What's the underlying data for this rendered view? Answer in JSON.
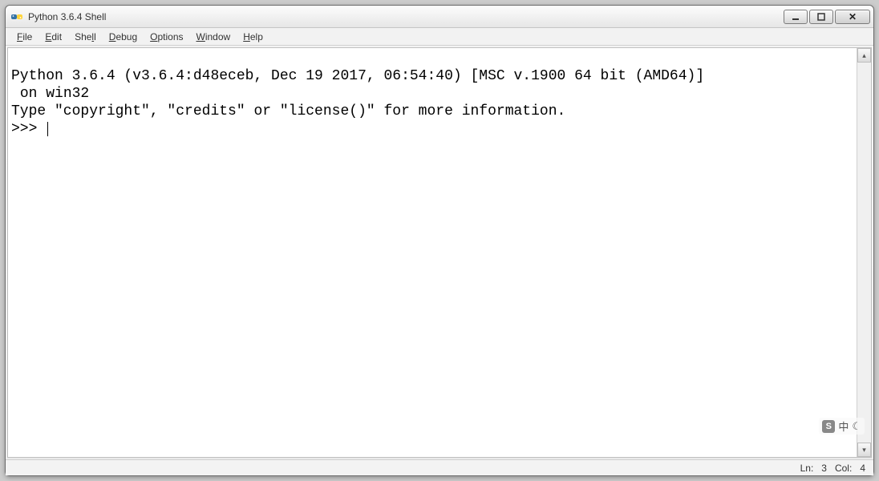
{
  "window": {
    "title": "Python 3.6.4 Shell"
  },
  "menubar": {
    "items": [
      {
        "hotkey": "F",
        "rest": "ile"
      },
      {
        "hotkey": "E",
        "rest": "dit"
      },
      {
        "hotkey": "",
        "rest": "She",
        "hotkey2": "l",
        "rest2": "l"
      },
      {
        "hotkey": "D",
        "rest": "ebug"
      },
      {
        "hotkey": "O",
        "rest": "ptions"
      },
      {
        "hotkey": "W",
        "rest": "indow"
      },
      {
        "hotkey": "H",
        "rest": "elp"
      }
    ]
  },
  "editor": {
    "line1": "Python 3.6.4 (v3.6.4:d48eceb, Dec 19 2017, 06:54:40) [MSC v.1900 64 bit (AMD64)]",
    "line2": " on win32",
    "line3": "Type \"copyright\", \"credits\" or \"license()\" for more information.",
    "prompt": ">>> "
  },
  "statusbar": {
    "ln_label": "Ln:",
    "ln_value": "3",
    "col_label": "Col:",
    "col_value": "4"
  },
  "ime": {
    "badge": "S",
    "lang": "中",
    "moon": "☾"
  }
}
